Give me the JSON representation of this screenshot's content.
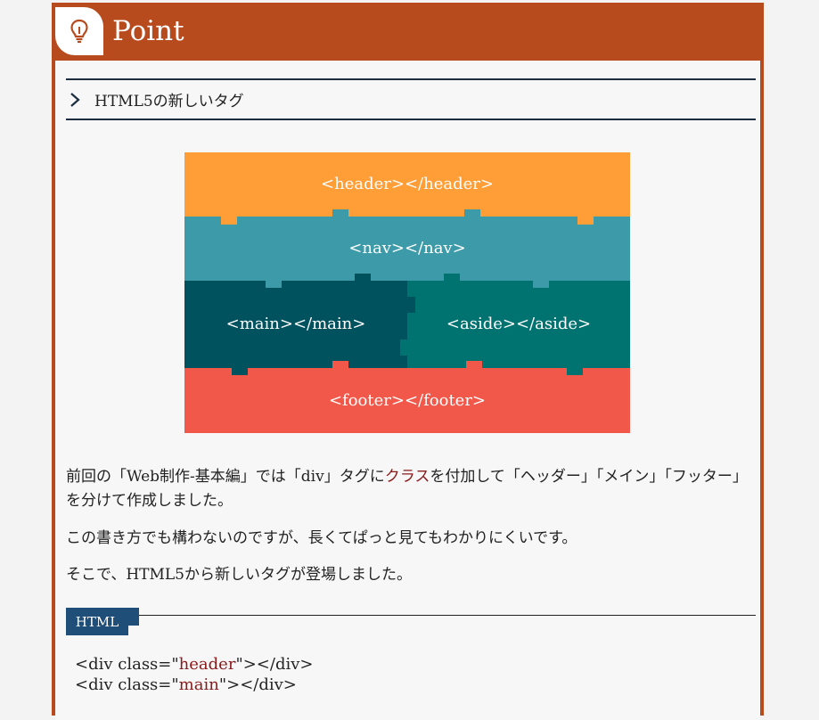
{
  "header": {
    "title": "Point",
    "icon": "lightbulb-icon"
  },
  "section": {
    "title": "HTML5の新しいタグ"
  },
  "diagram": {
    "header_label": "<header></header>",
    "nav_label": "<nav></nav>",
    "main_label": "<main></main>",
    "aside_label": "<aside></aside>",
    "footer_label": "<footer></footer>",
    "colors": {
      "header": "#ff9d37",
      "nav": "#3d9aa8",
      "main": "#00525f",
      "aside": "#007270",
      "footer": "#f2584a"
    }
  },
  "body": {
    "p1_before": "前回の「Web制作-基本編」では「div」タグに",
    "p1_accent": "クラス",
    "p1_after": "を付加して「ヘッダー」「メイン」「フッター」を分けて作成しました。",
    "p2": "この書き方でも構わないのですが、長くてぱっと見てもわかりにくいです。",
    "p3": "そこで、HTML5から新しいタグが登場しました。"
  },
  "code": {
    "tab_label": "HTML",
    "line1_pre": "<div class=\"",
    "line1_val": "header",
    "line1_post": "\"></div>",
    "line2_pre": "<div class=\"",
    "line2_val": "main",
    "line2_post": "\"></div>"
  }
}
